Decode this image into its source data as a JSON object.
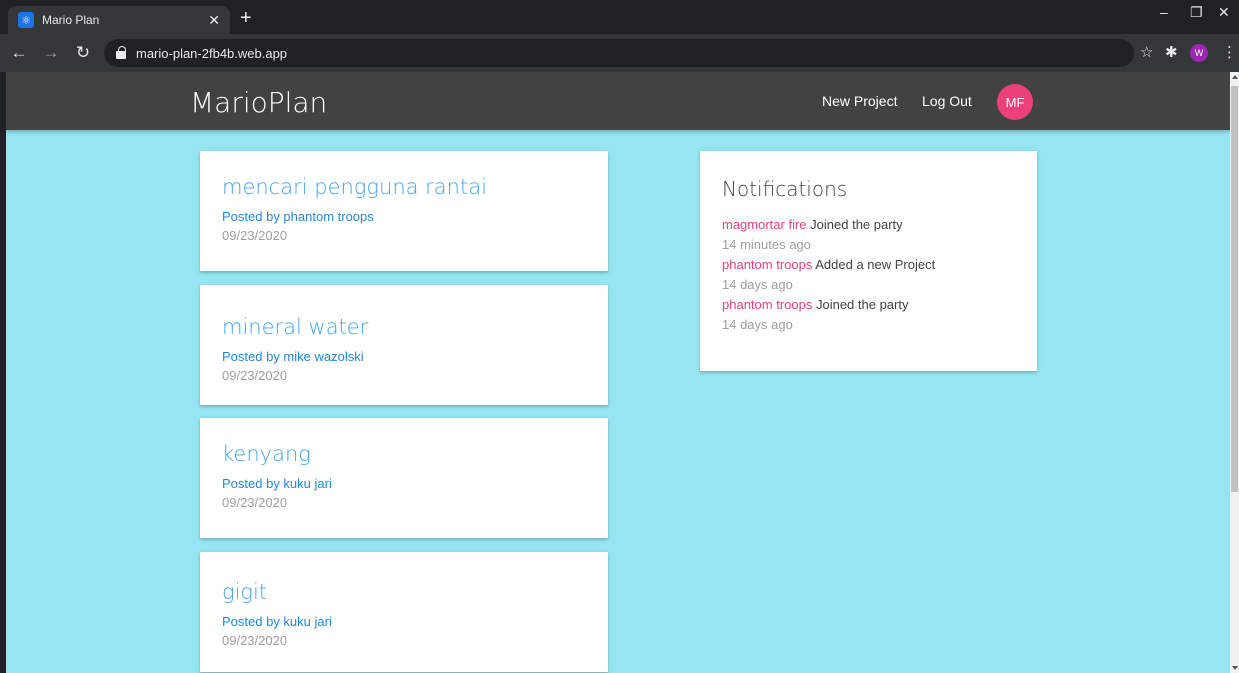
{
  "browser": {
    "tab_title": "Mario Plan",
    "url": "mario-plan-2fb4b.web.app",
    "profile_initial": "W"
  },
  "navbar": {
    "brand": "MarioPlan",
    "links": [
      "New Project",
      "Log Out"
    ],
    "avatar_initials": "MF"
  },
  "projects": [
    {
      "title": "mencari pengguna rantai",
      "author": "Posted by phantom troops",
      "date": "09/23/2020"
    },
    {
      "title": "mineral water",
      "author": "Posted by mike wazolski",
      "date": "09/23/2020"
    },
    {
      "title": "kenyang",
      "author": "Posted by kuku jari",
      "date": "09/23/2020"
    },
    {
      "title": "gigit",
      "author": "Posted by kuku jari",
      "date": "09/23/2020"
    }
  ],
  "notifications": {
    "title": "Notifications",
    "items": [
      {
        "user": "magmortar fire",
        "content": "Joined the party",
        "time": "14 minutes ago"
      },
      {
        "user": "phantom troops",
        "content": "Added a new Project",
        "time": "14 days ago"
      },
      {
        "user": "phantom troops",
        "content": "Joined the party",
        "time": "14 days ago"
      }
    ]
  },
  "colors": {
    "page_background": "#96e6f2",
    "navbar": "#424242",
    "avatar": "#ec407a",
    "project_title": "#42a5f5",
    "notification_user": "#ec407a"
  }
}
